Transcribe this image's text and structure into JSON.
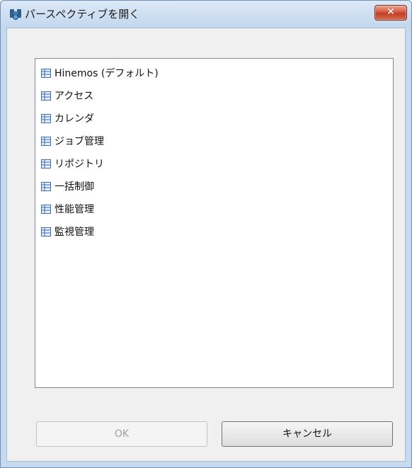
{
  "window": {
    "title": "パースペクティブを開く",
    "close_label": "✕"
  },
  "list": {
    "items": [
      {
        "label": "Hinemos (デフォルト)"
      },
      {
        "label": "アクセス"
      },
      {
        "label": "カレンダ"
      },
      {
        "label": "ジョブ管理"
      },
      {
        "label": "リポジトリ"
      },
      {
        "label": "一括制御"
      },
      {
        "label": "性能管理"
      },
      {
        "label": "監視管理"
      }
    ]
  },
  "buttons": {
    "ok_label": "OK",
    "cancel_label": "キャンセル"
  },
  "colors": {
    "icon_blue": "#3b6fb0",
    "icon_fill": "#e6eef9"
  }
}
